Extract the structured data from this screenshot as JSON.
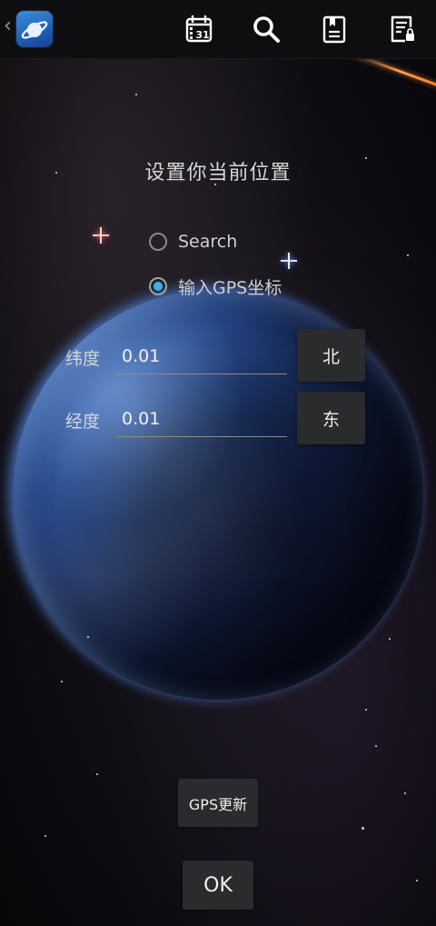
{
  "topbar": {
    "icons": [
      "back-chevron-icon",
      "app-logo-icon",
      "calendar-icon",
      "search-icon",
      "bookmark-list-icon",
      "locked-document-icon"
    ],
    "calendar_day": "31"
  },
  "dialog": {
    "title": "设置你当前位置",
    "options": [
      {
        "label": "Search",
        "checked": false
      },
      {
        "label": "输入GPS坐标",
        "checked": true
      }
    ],
    "latitude": {
      "label": "纬度",
      "value": "0.01",
      "hemisphere": "北"
    },
    "longitude": {
      "label": "经度",
      "value": "0.01",
      "hemisphere": "东"
    },
    "gps_update_label": "GPS更新",
    "ok_label": "OK"
  },
  "colors": {
    "radio_selected": "#35b5e8",
    "button_bg": "#2a2b2d",
    "topbar_bg": "#0e0e10"
  }
}
